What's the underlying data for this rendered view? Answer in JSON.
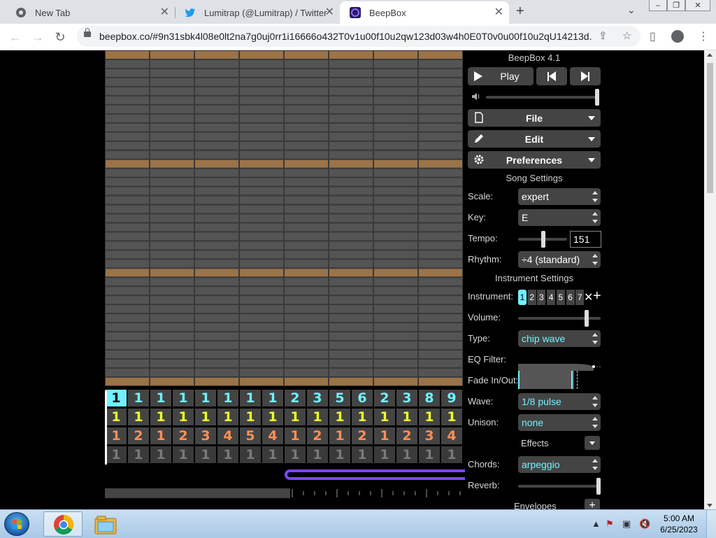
{
  "browser": {
    "tabs": [
      {
        "label": "New Tab",
        "icon": "chrome-icon",
        "active": false
      },
      {
        "label": "Lumitrap (@Lumitrap) / Twitter",
        "icon": "twitter-icon",
        "active": false
      },
      {
        "label": "BeepBox",
        "icon": "beepbox-icon",
        "active": true
      }
    ],
    "url": "beepbox.co/#9n31sbk4l08e0lt2na7g0uj0rr1i16666o432T0v1u00f10u2qw123d03w4h0E0T0v0u00f10u2qU14213d...",
    "new_tab_symbol": "+",
    "window_controls": [
      "minimize",
      "maximize",
      "close"
    ]
  },
  "app": {
    "title": "BeepBox 4.1",
    "play_label": "Play",
    "menus": [
      {
        "label": "File",
        "icon": "file-icon"
      },
      {
        "label": "Edit",
        "icon": "pencil-icon"
      },
      {
        "label": "Preferences",
        "icon": "gear-icon"
      }
    ],
    "song_settings_header": "Song Settings",
    "scale_label": "Scale:",
    "scale_value": "expert",
    "key_label": "Key:",
    "key_value": "E",
    "tempo_label": "Tempo:",
    "tempo_value": "151",
    "tempo_slider_fraction": 0.52,
    "rhythm_label": "Rhythm:",
    "rhythm_value": "÷4 (standard)",
    "instrument_settings_header": "Instrument Settings",
    "instrument_label": "Instrument:",
    "instruments": [
      "1",
      "2",
      "3",
      "4",
      "5",
      "6",
      "7"
    ],
    "selected_instrument": "1",
    "volume_label": "Volume:",
    "volume_fraction": 0.85,
    "master_volume_fraction": 1.0,
    "type_label": "Type:",
    "type_value": "chip wave",
    "eq_filter_label": "EQ Filter:",
    "fade_label": "Fade In/Out:",
    "wave_label": "Wave:",
    "wave_value": "1/8 pulse",
    "unison_label": "Unison:",
    "unison_value": "none",
    "effects_label": "Effects",
    "chords_label": "Chords:",
    "chords_value": "arpeggio",
    "reverb_label": "Reverb:",
    "reverb_fraction": 1.0,
    "envelopes_label": "Envelopes",
    "track_rows": [
      {
        "color": "#70f1ff",
        "cells": [
          "1",
          "1",
          "1",
          "1",
          "1",
          "1",
          "1",
          "1",
          "2",
          "3",
          "5",
          "6",
          "2",
          "3",
          "8",
          "9"
        ]
      },
      {
        "color": "#f0ff30",
        "cells": [
          "1",
          "1",
          "1",
          "1",
          "1",
          "1",
          "1",
          "1",
          "1",
          "1",
          "1",
          "1",
          "1",
          "1",
          "1",
          "1"
        ]
      },
      {
        "color": "#ff8f56",
        "cells": [
          "1",
          "2",
          "1",
          "2",
          "3",
          "4",
          "5",
          "4",
          "1",
          "2",
          "1",
          "2",
          "1",
          "2",
          "3",
          "4"
        ]
      },
      {
        "color": "#7a7a7a",
        "cells": [
          "1",
          "1",
          "1",
          "1",
          "1",
          "1",
          "1",
          "1",
          "1",
          "1",
          "1",
          "1",
          "1",
          "1",
          "1",
          "1"
        ]
      }
    ],
    "selected_track_cell": 0
  },
  "taskbar": {
    "time": "5:00 AM",
    "date": "6/25/2023",
    "pinned": [
      "chrome-icon",
      "explorer-icon"
    ]
  },
  "colors": {
    "accent_cyan": "#70f1ff",
    "octave_row": "#9b7348",
    "loop_bar": "#7a46ff"
  }
}
